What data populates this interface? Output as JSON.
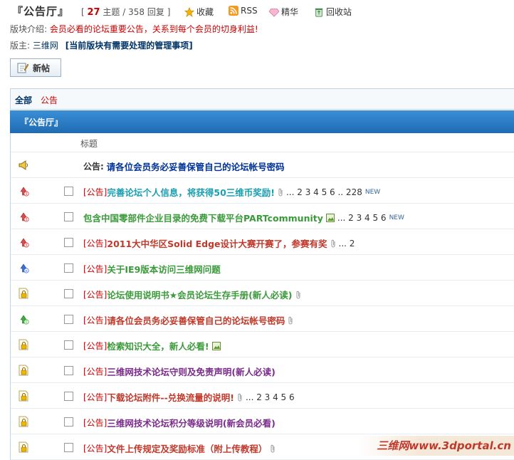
{
  "header": {
    "title": "『公告厅』",
    "topics": "27",
    "topics_label": "主题",
    "sep": "/",
    "replies": "358 回复",
    "favorite": "收藏",
    "rss": "RSS",
    "digest": "精华",
    "recycle": "回收站"
  },
  "intro": {
    "label": "版块介绍:",
    "text": "会员必看的论坛重要公告，关系到每个会员的切身利益!"
  },
  "moderators": {
    "label": "版主:",
    "name": "三维网",
    "mgmt": "[当前版块有需要处理的管理事项]"
  },
  "new_post": "新帖",
  "tabs": {
    "all": "全部",
    "ann": "公告"
  },
  "section_title": "『公告厅』",
  "col_title": "标题",
  "announcement": {
    "prefix": "公告:",
    "title": "请各位会员务必妥善保管自己的论坛帐号密码"
  },
  "threads": [
    {
      "icon": "hot3",
      "cat": "[公告]",
      "title": "完善论坛个人信息，将获得50三维币奖励!",
      "color": "#1a9fb0",
      "clip": true,
      "img": false,
      "pages": "... 2 3 4 5 6 .. 228",
      "new": "NEW",
      "nocat": false
    },
    {
      "icon": "hot3",
      "cat": "",
      "title": "包含中国零部件企业目录的免费下载平台PARTcommunity",
      "color": "#3a9a3a",
      "clip": false,
      "img": true,
      "pages": "... 2 3 4 5 6",
      "new": "NEW",
      "nocat": true
    },
    {
      "icon": "hot3",
      "cat": "[公告]",
      "title": "2011大中华区Solid Edge设计大赛开赛了，参赛有奖",
      "color": "#c0392b",
      "clip": true,
      "img": false,
      "pages": "... 2",
      "new": "",
      "nocat": false
    },
    {
      "icon": "ie",
      "cat": "[公告]",
      "title": "关于IE9版本访问三维网问题",
      "color": "#3a9a3a",
      "clip": false,
      "img": false,
      "pages": "",
      "new": "",
      "nocat": false
    },
    {
      "icon": "lock",
      "cat": "[公告]",
      "title": "论坛使用说明书★会员论坛生存手册(新人必读)",
      "color": "#3a9a3a",
      "clip": true,
      "img": false,
      "pages": "",
      "new": "",
      "nocat": false
    },
    {
      "icon": "green",
      "cat": "[公告]",
      "title": "请各位会员务必妥善保管自己的论坛帐号密码",
      "color": "#c0392b",
      "clip": true,
      "img": false,
      "pages": "",
      "new": "",
      "nocat": false
    },
    {
      "icon": "lock",
      "cat": "[公告]",
      "title": "检索知识大全，新人必看!",
      "color": "#3a9a3a",
      "clip": false,
      "img": true,
      "pages": "",
      "new": "",
      "nocat": false
    },
    {
      "icon": "lock",
      "cat": "[公告]",
      "title": "三维网技术论坛守则及免责声明(新人必读)",
      "color": "#7a2a8a",
      "clip": false,
      "img": false,
      "pages": "",
      "new": "",
      "nocat": false
    },
    {
      "icon": "lock",
      "cat": "[公告]",
      "title": "下载论坛附件--兑换流量的说明!",
      "color": "#c0392b",
      "clip": true,
      "img": false,
      "pages": "... 2 3 4 5 6",
      "new": "",
      "nocat": false
    },
    {
      "icon": "lock",
      "cat": "[公告]",
      "title": "三维网技术论坛积分等级说明(新会员必看)",
      "color": "#7a2a8a",
      "clip": false,
      "img": false,
      "pages": "",
      "new": "",
      "nocat": false
    },
    {
      "icon": "lock",
      "cat": "[公告]",
      "title": "文件上传规定及奖励标准（附上传教程）",
      "color": "#c0392b",
      "clip": true,
      "img": false,
      "pages": "",
      "new": "",
      "nocat": false
    }
  ],
  "watermark": "三维网www.3dportal.cn"
}
